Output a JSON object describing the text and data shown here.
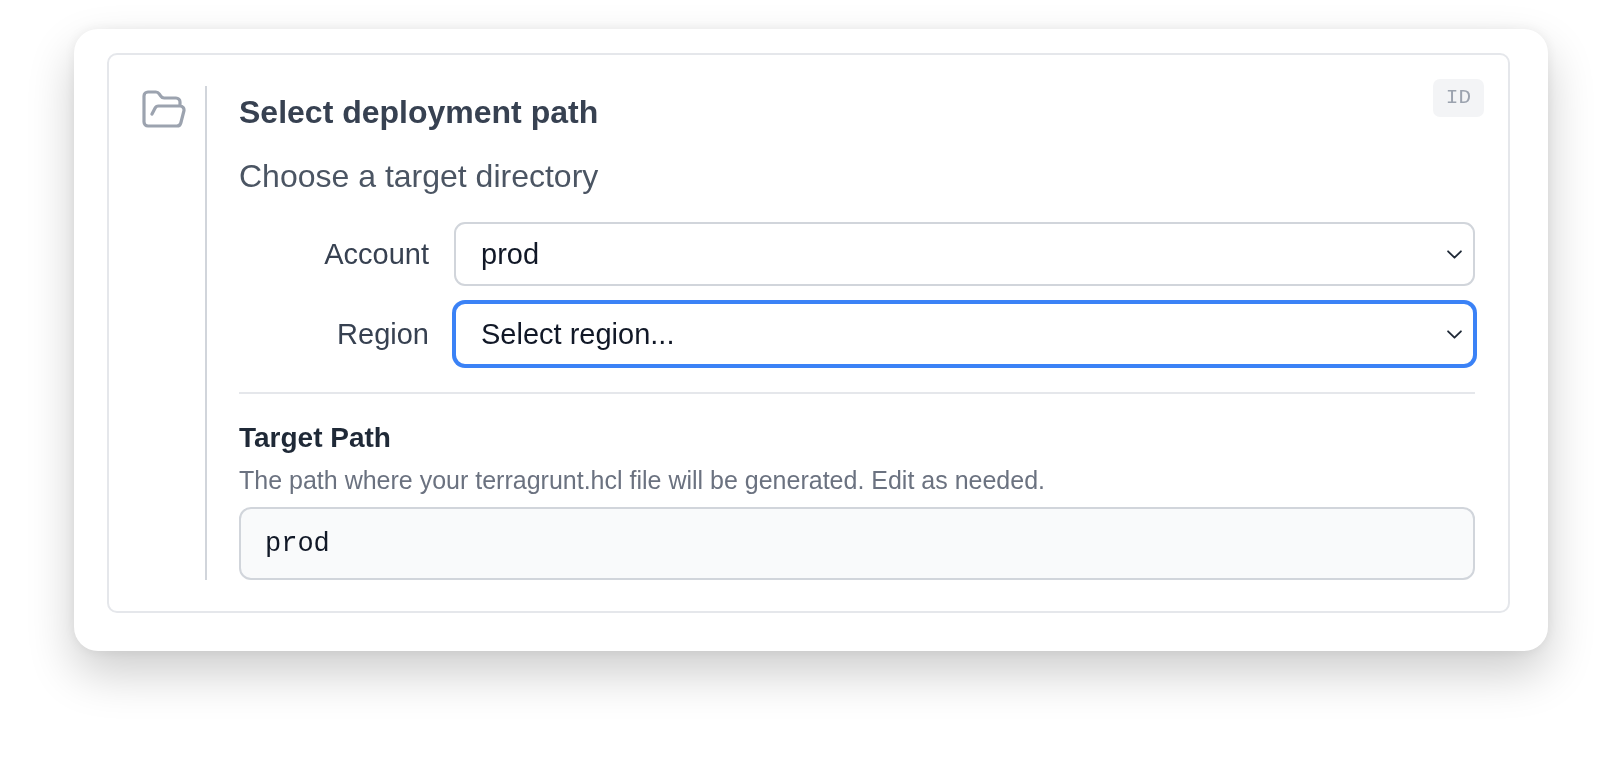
{
  "card": {
    "title": "Select deployment path",
    "subtitle": "Choose a target directory",
    "badge": "ID"
  },
  "fields": [
    {
      "label": "Account",
      "value": "prod",
      "focused": false
    },
    {
      "label": "Region",
      "placeholder": "Select region...",
      "focused": true
    }
  ],
  "target_path": {
    "label": "Target Path",
    "help": "The path where your terragrunt.hcl file will be generated. Edit as needed.",
    "value": "prod"
  }
}
